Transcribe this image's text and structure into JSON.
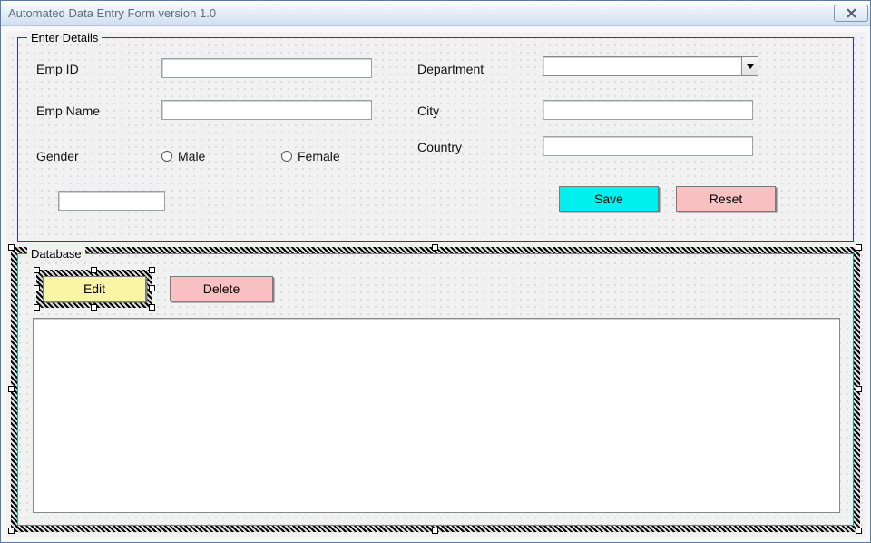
{
  "window": {
    "title": "Automated Data Entry Form version 1.0"
  },
  "enter_details": {
    "legend": "Enter Details",
    "emp_id_label": "Emp ID",
    "emp_name_label": "Emp Name",
    "gender_label": "Gender",
    "male_label": "Male",
    "female_label": "Female",
    "department_label": "Department",
    "city_label": "City",
    "country_label": "Country",
    "emp_id_value": "",
    "emp_name_value": "",
    "city_value": "",
    "country_value": "",
    "department_selected": "",
    "extra_box_value": "",
    "save_label": "Save",
    "reset_label": "Reset"
  },
  "database": {
    "legend": "Database",
    "edit_label": "Edit",
    "delete_label": "Delete"
  },
  "colors": {
    "frame_enter": "#2a2aff",
    "frame_db": "#00b3a4",
    "btn_save": "#00f0f0",
    "btn_pink": "#f8c0c0",
    "btn_yellow": "#faf5a5"
  }
}
